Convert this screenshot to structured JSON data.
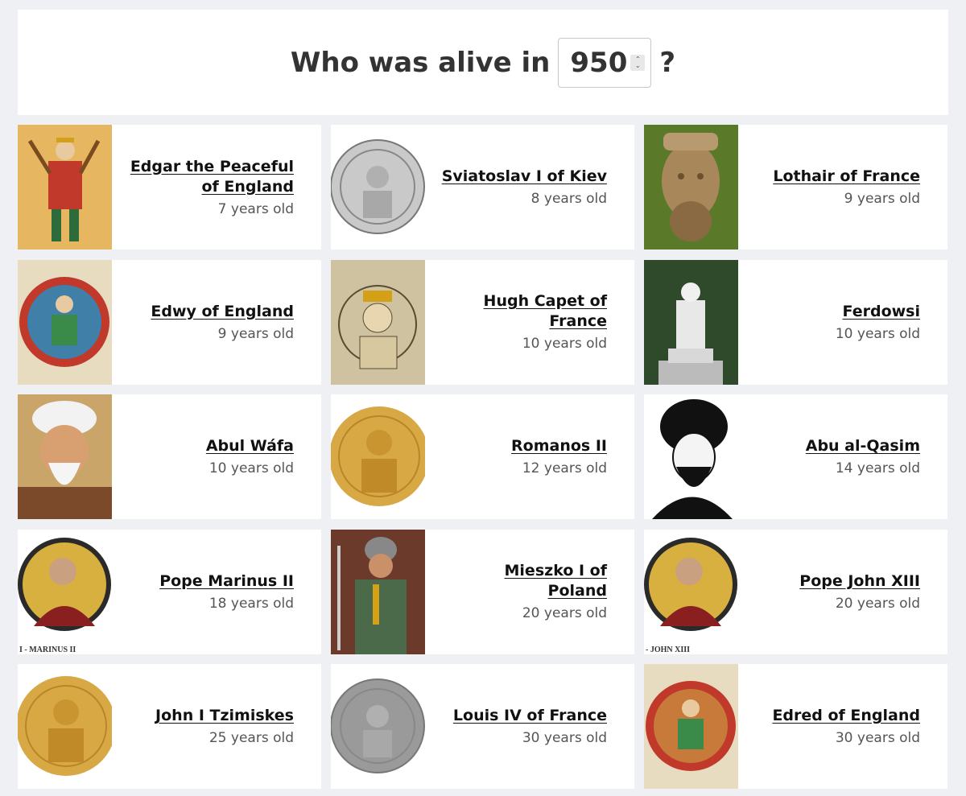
{
  "header": {
    "prefix": "Who was alive in",
    "year": "950",
    "suffix": "?"
  },
  "people": [
    {
      "name": "Edgar the Peaceful of England",
      "age": "7 years old",
      "portrait": "manuscript-king",
      "color": "#d9a24a"
    },
    {
      "name": "Sviatoslav I of Kiev",
      "age": "8 years old",
      "portrait": "silver-coin",
      "color": "#c9c9c9"
    },
    {
      "name": "Lothair of France",
      "age": "9 years old",
      "portrait": "stone-bust",
      "color": "#a8875a"
    },
    {
      "name": "Edwy of England",
      "age": "9 years old",
      "portrait": "roundel-king",
      "color": "#3f7fa8"
    },
    {
      "name": "Hugh Capet of France",
      "age": "10 years old",
      "portrait": "drawing-king",
      "color": "#cfc2a0"
    },
    {
      "name": "Ferdowsi",
      "age": "10 years old",
      "portrait": "statue",
      "color": "#2f4a2a"
    },
    {
      "name": "Abul Wáfa",
      "age": "10 years old",
      "portrait": "painted-scholar",
      "color": "#c9a56a"
    },
    {
      "name": "Romanos II",
      "age": "12 years old",
      "portrait": "gold-coin",
      "color": "#d8a845"
    },
    {
      "name": "Abu al-Qasim",
      "age": "14 years old",
      "portrait": "ink-portrait",
      "color": "#111111"
    },
    {
      "name": "Pope Marinus II",
      "age": "18 years old",
      "portrait": "papal-roundel",
      "color": "#8a1f1f"
    },
    {
      "name": "Mieszko I of Poland",
      "age": "20 years old",
      "portrait": "painted-warrior",
      "color": "#6b3a2a"
    },
    {
      "name": "Pope John XIII",
      "age": "20 years old",
      "portrait": "papal-roundel",
      "color": "#8a1f1f"
    },
    {
      "name": "John I Tzimiskes",
      "age": "25 years old",
      "portrait": "gold-coin",
      "color": "#d8a845"
    },
    {
      "name": "Louis IV of France",
      "age": "30 years old",
      "portrait": "silver-coin",
      "color": "#9a9a9a"
    },
    {
      "name": "Edred of England",
      "age": "30 years old",
      "portrait": "roundel-king",
      "color": "#c77a3a"
    }
  ],
  "captions": {
    "marinus": "I - MARINUS II",
    "john": "- JOHN XIII"
  }
}
